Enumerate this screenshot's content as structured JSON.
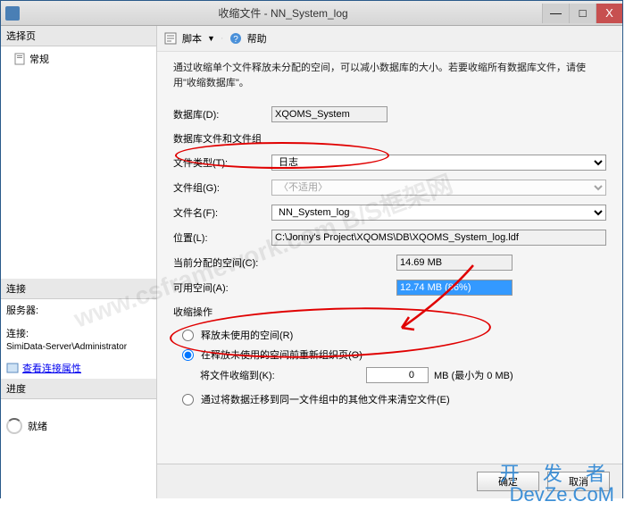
{
  "window": {
    "title": "收缩文件 - NN_System_log",
    "min": "—",
    "max": "□",
    "close": "X"
  },
  "leftPanel": {
    "selectPage": "选择页",
    "general": "常规",
    "connection": "连接",
    "serverLabel": "服务器:",
    "serverValue": "",
    "connLabel": "连接:",
    "connValue": "SimiData-Server\\Administrator",
    "viewConnProps": "查看连接属性",
    "progress": "进度",
    "ready": "就绪"
  },
  "toolbar": {
    "script": "脚本",
    "help": "帮助"
  },
  "content": {
    "description": "通过收缩单个文件释放未分配的空间，可以减小数据库的大小。若要收缩所有数据库文件，请使用\"收缩数据库\"。",
    "dbLabel": "数据库(D):",
    "dbValue": "XQOMS_System",
    "filesGroupHeader": "数据库文件和文件组",
    "fileTypeLabel": "文件类型(T):",
    "fileTypeValue": "日志",
    "fileGroupLabel": "文件组(G):",
    "fileGroupValue": "〈不适用〉",
    "fileNameLabel": "文件名(F):",
    "fileNameValue": "NN_System_log",
    "locationLabel": "位置(L):",
    "locationValue": "C:\\Jonny's Project\\XQOMS\\DB\\XQOMS_System_log.ldf",
    "allocatedLabel": "当前分配的空间(C):",
    "allocatedValue": "14.69 MB",
    "availableLabel": "可用空间(A):",
    "availableValue": "12.74 MB (86%)",
    "shrinkActionHeader": "收缩操作",
    "radio1": "释放未使用的空间(R)",
    "radio2": "在释放未使用的空间前重新组织页(O)",
    "shrinkToLabel": "将文件收缩到(K):",
    "shrinkToValue": "0",
    "shrinkToUnit": "MB (最小为 0 MB)",
    "radio3": "通过将数据迁移到同一文件组中的其他文件来清空文件(E)"
  },
  "buttons": {
    "ok": "确定",
    "cancel": "取消"
  },
  "watermarks": {
    "bg": "www.csframework.com  B/S框架网",
    "brand1": "开 发 者",
    "brand2": "DevZe.CoM"
  }
}
